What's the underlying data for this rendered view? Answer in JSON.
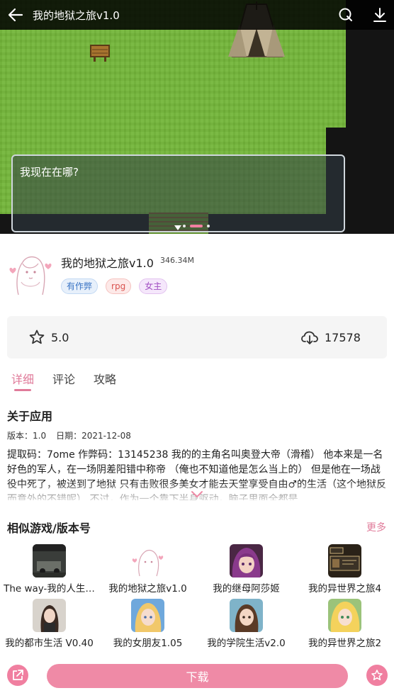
{
  "banner": {
    "title": "我的地狱之旅v1.0",
    "dialog_text": "我现在在哪?",
    "carousel": {
      "count": 3,
      "active_index": 1
    }
  },
  "app": {
    "name": "我的地狱之旅v1.0",
    "size": "346.34M",
    "tags": [
      "有作弊",
      "rpg",
      "女主"
    ]
  },
  "stats": {
    "rating": "5.0",
    "downloads": "17578"
  },
  "tabs": [
    "详细",
    "评论",
    "攻略"
  ],
  "about": {
    "title": "关于应用",
    "version_label": "版本：1.0",
    "date_label": "日期：2021-12-08",
    "description": "提取码：7ome 作弊码：13145238 我的的主角名叫奥登大帝（滑稽） 他本来是一名好色的军人，在一场阴差阳错中称帝 （俺也不知道他是怎么当上的） 但是他在一场战役中死了，被送到了地狱 只有击败很多美女才能去天堂享受自由♂的生活（这个地狱反而意外的不错呢） 不过，作为一个靠下半身驱动，脑子里面全都是"
  },
  "similar": {
    "title": "相似游戏/版本号",
    "more_label": "更多",
    "games": [
      {
        "name": "The way-我的人生…",
        "thumb": "dark-scene"
      },
      {
        "name": "我的地狱之旅v1.0",
        "thumb": "sketch-girl"
      },
      {
        "name": "我的继母阿莎姬",
        "thumb": "purple-hair"
      },
      {
        "name": "我的异世界之旅4",
        "thumb": "rpg-window"
      },
      {
        "name": "我的都市生活 V0.40",
        "thumb": "street-girl"
      },
      {
        "name": "我的女朋友1.05",
        "thumb": "blonde-girl"
      },
      {
        "name": "我的学院生活v2.0",
        "thumb": "brown-hair"
      },
      {
        "name": "我的异世界之旅2",
        "thumb": "blonde-anime"
      }
    ]
  },
  "bottom": {
    "download_label": "下载"
  },
  "colors": {
    "accent": "#e07b9a",
    "button": "#ef8aa6",
    "grass": "#74b63a"
  }
}
